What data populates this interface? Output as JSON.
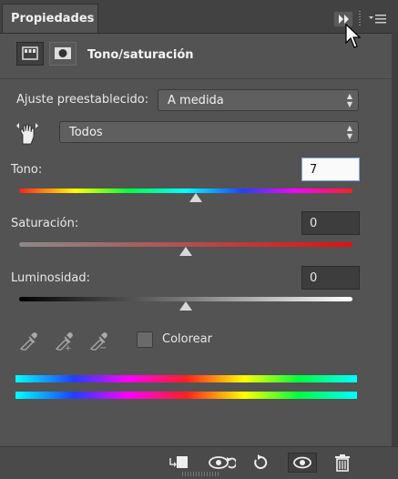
{
  "panel": {
    "tab_label": "Propiedades",
    "title": "Tono/saturación",
    "collapse_icon": "double-chevron-right-icon",
    "menu_icon": "panel-menu-icon"
  },
  "preset": {
    "label": "Ajuste preestablecido:",
    "value": "A medida"
  },
  "channel": {
    "value": "Todos"
  },
  "sliders": {
    "hue": {
      "label": "Tono:",
      "value": "7",
      "fraction": 0.53
    },
    "saturation": {
      "label": "Saturación:",
      "value": "0",
      "fraction": 0.5
    },
    "lightness": {
      "label": "Luminosidad:",
      "value": "0",
      "fraction": 0.5
    }
  },
  "colorize": {
    "label": "Colorear",
    "checked": false
  },
  "colors": {
    "panel_bg": "#535353",
    "field_active_border": "#8aa8d8"
  }
}
